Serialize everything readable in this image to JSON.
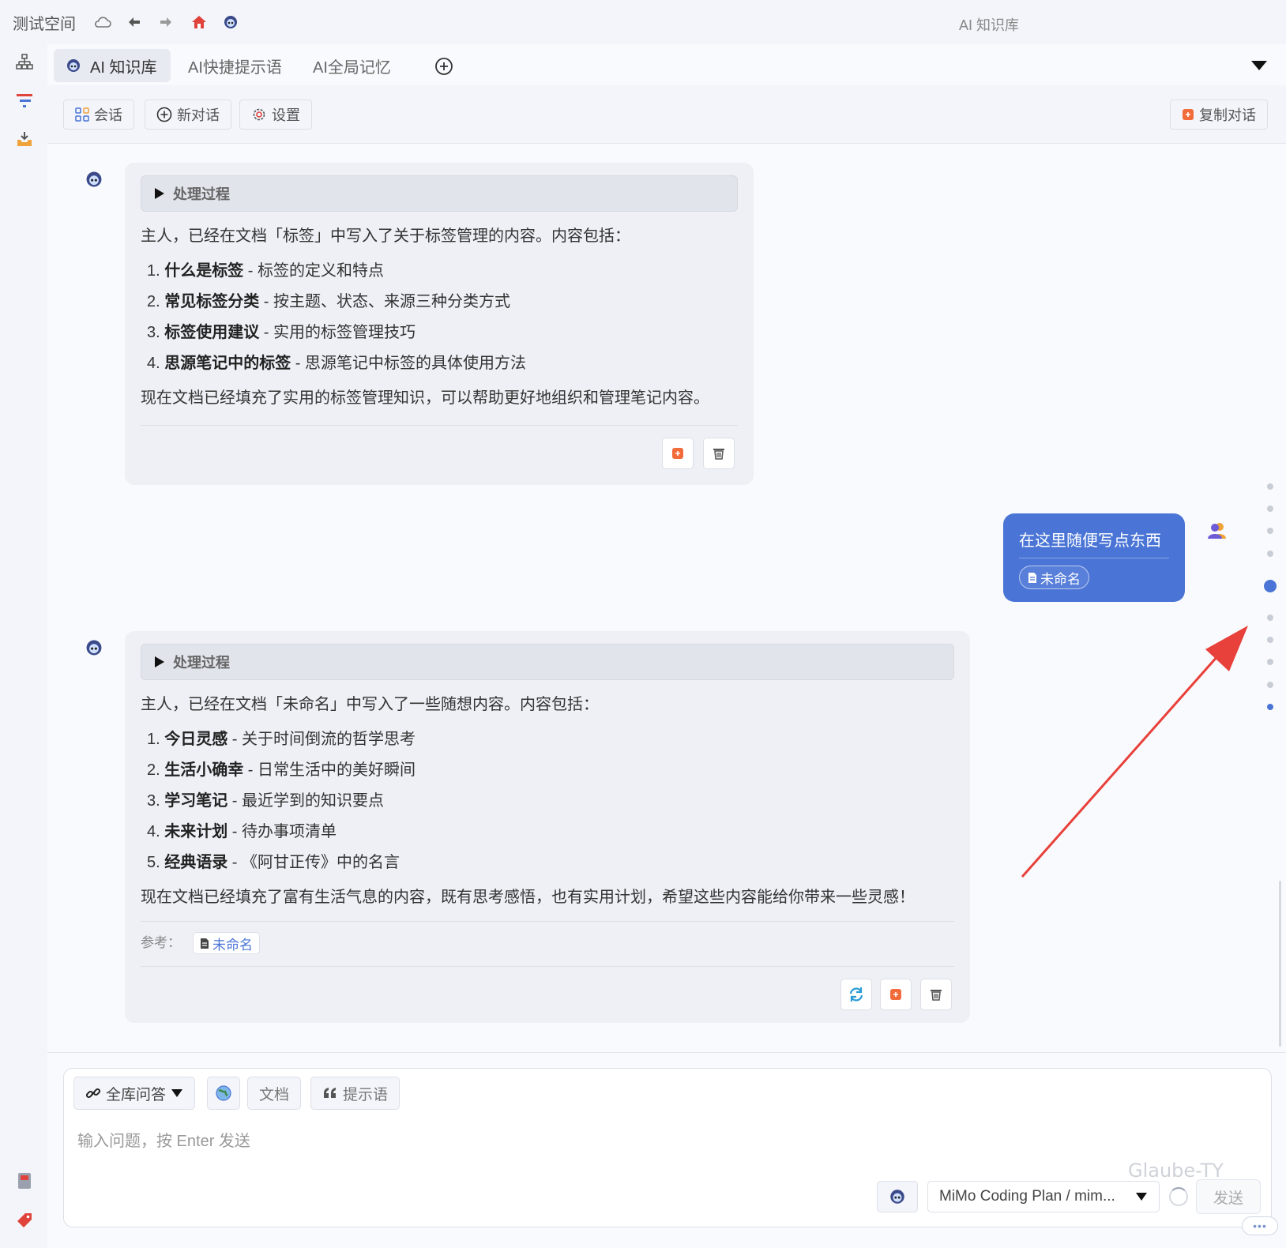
{
  "topbar": {
    "workspace": "测试空间",
    "panel_title": "AI 知识库"
  },
  "tabs": [
    {
      "label": "AI 知识库"
    },
    {
      "label": "AI快捷提示语"
    },
    {
      "label": "AI全局记忆"
    }
  ],
  "toolbar": {
    "session": "会话",
    "new_chat": "新对话",
    "settings": "设置",
    "copy_chat": "复制对话"
  },
  "messages": [
    {
      "role": "assistant",
      "process": "处理过程",
      "intro": "主人，已经在文档「标签」中写入了关于标签管理的内容。内容包括：",
      "items": [
        {
          "num": "1.",
          "title": "什么是标签",
          "desc": " - 标签的定义和特点"
        },
        {
          "num": "2.",
          "title": "常见标签分类",
          "desc": " - 按主题、状态、来源三种分类方式"
        },
        {
          "num": "3.",
          "title": "标签使用建议",
          "desc": " - 实用的标签管理技巧"
        },
        {
          "num": "4.",
          "title": "思源笔记中的标签",
          "desc": " - 思源笔记中标签的具体使用方法"
        }
      ],
      "outro": "现在文档已经填充了实用的标签管理知识，可以帮助更好地组织和管理笔记内容。"
    },
    {
      "role": "user",
      "text": "在这里随便写点东西",
      "doc": "未命名"
    },
    {
      "role": "assistant",
      "process": "处理过程",
      "intro": "主人，已经在文档「未命名」中写入了一些随想内容。内容包括：",
      "items": [
        {
          "num": "1.",
          "title": "今日灵感",
          "desc": " - 关于时间倒流的哲学思考"
        },
        {
          "num": "2.",
          "title": "生活小确幸",
          "desc": " - 日常生活中的美好瞬间"
        },
        {
          "num": "3.",
          "title": "学习笔记",
          "desc": " - 最近学到的知识要点"
        },
        {
          "num": "4.",
          "title": "未来计划",
          "desc": " - 待办事项清单"
        },
        {
          "num": "5.",
          "title": "经典语录",
          "desc": " - 《阿甘正传》中的名言"
        }
      ],
      "outro": "现在文档已经填充了富有生活气息的内容，既有思考感悟，也有实用计划，希望这些内容能给你带来一些灵感！",
      "ref_label": "参考：",
      "ref_doc": "未命名"
    }
  ],
  "input": {
    "mode": "全库问答",
    "doc_btn": "文档",
    "prompt_btn": "提示语",
    "placeholder": "输入问题，按 Enter 发送",
    "model": "MiMo Coding Plan / mim...",
    "send": "发送",
    "watermark": "Glaube-TY",
    "more": "•••"
  },
  "colors": {
    "accent": "#4a75d6",
    "annotation_arrow": "#e8403a"
  }
}
